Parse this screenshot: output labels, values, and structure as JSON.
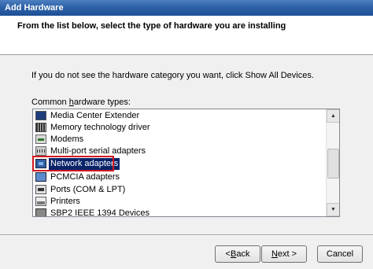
{
  "window": {
    "title": "Add Hardware"
  },
  "header": {
    "title": "From the list below, select the type of hardware you are installing"
  },
  "hint": "If you do not see the hardware category you want, click Show All Devices.",
  "list_label": {
    "before": "Common ",
    "accel": "h",
    "after": "ardware types:"
  },
  "hardware_types": [
    {
      "label": "Media Center Extender",
      "icon": "media-center-icon"
    },
    {
      "label": "Memory technology driver",
      "icon": "memory-chip-icon"
    },
    {
      "label": "Modems",
      "icon": "modem-icon"
    },
    {
      "label": "Multi-port serial adapters",
      "icon": "serial-port-icon"
    },
    {
      "label": "Network adapters",
      "icon": "network-adapter-icon",
      "selected": true
    },
    {
      "label": "PCMCIA adapters",
      "icon": "pcmcia-icon"
    },
    {
      "label": "Ports (COM & LPT)",
      "icon": "port-icon"
    },
    {
      "label": "Printers",
      "icon": "printer-icon"
    },
    {
      "label": "SBP2 IEEE 1394 Devices",
      "icon": "sbp2-device-icon"
    }
  ],
  "buttons": {
    "back": {
      "before": "< ",
      "accel": "B",
      "after": "ack"
    },
    "next": {
      "before": "",
      "accel": "N",
      "after": "ext >"
    },
    "cancel": "Cancel"
  },
  "colors": {
    "selection": "#0a246a",
    "callout": "#d4181f",
    "titlebar": "#2e62a8"
  }
}
